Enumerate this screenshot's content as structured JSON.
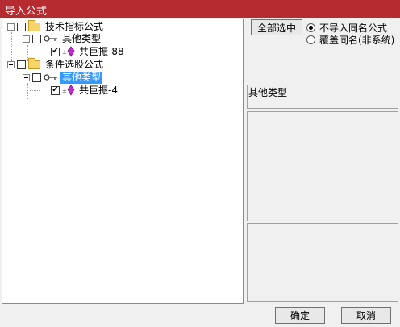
{
  "window": {
    "title": "导入公式"
  },
  "tree": {
    "root1": {
      "label": "技术指标公式"
    },
    "root1_child": {
      "label": "其他类型"
    },
    "root1_leaf": {
      "label": "共巨振-88"
    },
    "root2": {
      "label": "条件选股公式"
    },
    "root2_child": {
      "label": "其他类型"
    },
    "root2_leaf": {
      "label": "共巨振-4"
    }
  },
  "right": {
    "select_all_label": "全部选中",
    "options": [
      {
        "label": "不导入同名公式",
        "selected": true
      },
      {
        "label": "覆盖同名(非系统)",
        "selected": false
      }
    ],
    "info_text": "其他类型"
  },
  "footer": {
    "ok_label": "确定",
    "cancel_label": "取消"
  },
  "colors": {
    "titlebar": "#b52b30",
    "selection": "#3399ff"
  }
}
